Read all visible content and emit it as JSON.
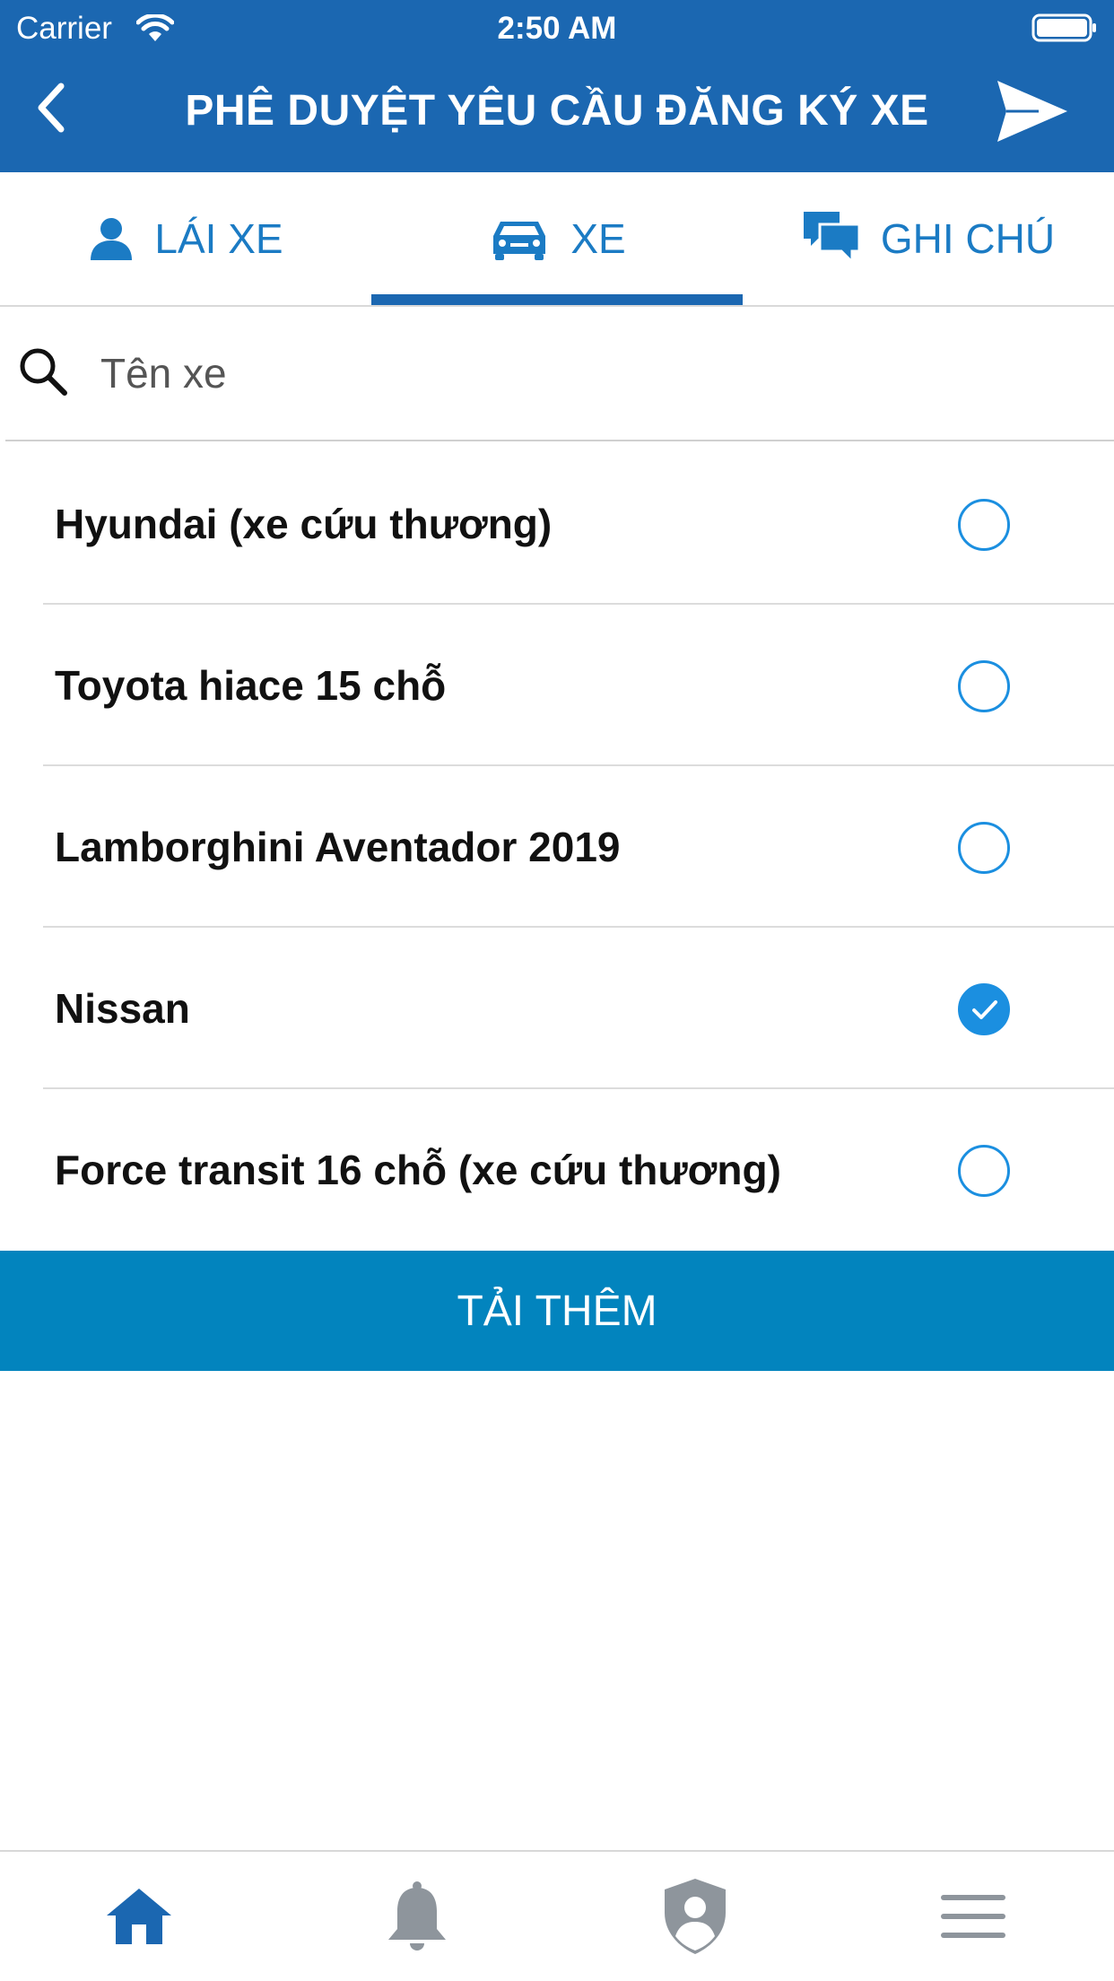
{
  "status_bar": {
    "carrier": "Carrier",
    "time": "2:50 AM"
  },
  "nav": {
    "title": "PHÊ DUYỆT YÊU CẦU ĐĂNG KÝ XE"
  },
  "tabs": [
    {
      "label": "LÁI XE",
      "icon": "person-icon",
      "active": false
    },
    {
      "label": "XE",
      "icon": "car-icon",
      "active": true
    },
    {
      "label": "GHI CHÚ",
      "icon": "chat-icon",
      "active": false
    }
  ],
  "search": {
    "placeholder": "Tên xe",
    "value": ""
  },
  "vehicles": [
    {
      "name": "Hyundai (xe cứu thương)",
      "selected": false
    },
    {
      "name": "Toyota hiace 15 chỗ",
      "selected": false
    },
    {
      "name": "Lamborghini Aventador 2019",
      "selected": false
    },
    {
      "name": "Nissan",
      "selected": true
    },
    {
      "name": "Force transit 16 chỗ (xe cứu thương)",
      "selected": false
    }
  ],
  "load_more": {
    "label": "TẢI THÊM"
  },
  "bottom_tabs": [
    {
      "icon": "home-icon",
      "active": true
    },
    {
      "icon": "bell-icon",
      "active": false
    },
    {
      "icon": "shield-user-icon",
      "active": false
    },
    {
      "icon": "menu-icon",
      "active": false
    }
  ],
  "colors": {
    "header": "#1B67B1",
    "accent": "#1B7BC4",
    "radio": "#1B8FE0",
    "load_more": "#0284BE",
    "inactive_icon": "#8E959C"
  }
}
